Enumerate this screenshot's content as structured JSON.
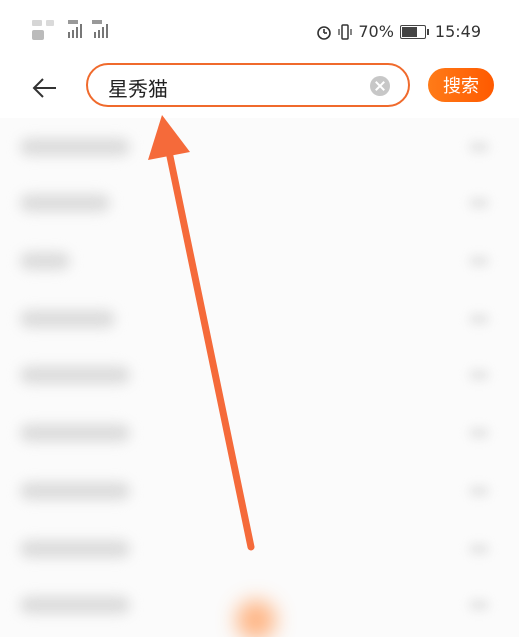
{
  "status_bar": {
    "alarm_icon": "alarm-clock-icon",
    "vibrate_icon": "vibrate-icon",
    "battery_percent": "70%",
    "battery_level": 0.7,
    "time": "15:49",
    "signal_icons": [
      "hd-icon",
      "signal-4g-icon",
      "signal-4g-icon"
    ]
  },
  "search": {
    "back_icon": "arrow-left-icon",
    "query": "星秀猫",
    "clear_icon": "clear-circle-icon",
    "button_label": "搜索",
    "accent_color": "#f06a2c",
    "button_color": "#ff6a0c"
  },
  "annotation": {
    "arrow_color": "#f56a3a"
  }
}
